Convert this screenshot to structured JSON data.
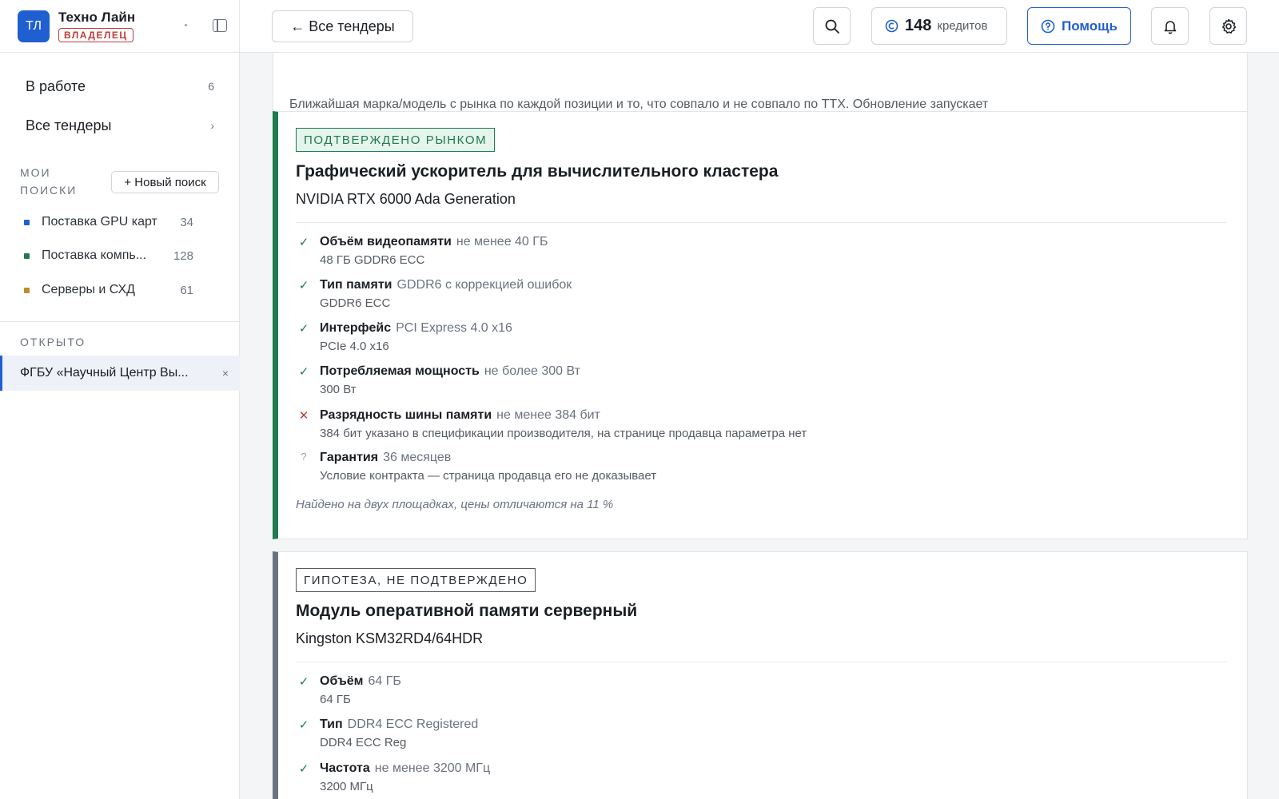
{
  "org": {
    "initials": "ТЛ",
    "name": "Техно Лайн",
    "role": "ВЛАДЕЛЕЦ"
  },
  "nav": {
    "in_work": {
      "label": "В работе",
      "count": "6"
    },
    "all_tenders": {
      "label": "Все тендеры",
      "arrow": "›"
    }
  },
  "my_searches": {
    "label_line1": "МОИ",
    "label_line2": "ПОИСКИ",
    "new_button": "+ Новый поиск",
    "items": [
      {
        "label": "Поставка GPU карт",
        "count": "34",
        "color": "#1f5fd1"
      },
      {
        "label": "Поставка компь...",
        "count": "128",
        "color": "#1f7a4c"
      },
      {
        "label": "Серверы и СХД",
        "count": "61",
        "color": "#c08a2e"
      }
    ]
  },
  "opened": {
    "label": "ОТКРЫТО",
    "item": "ФГБУ «Научный Центр Вы...",
    "close": "×"
  },
  "topbar": {
    "back": "← Все тендеры",
    "credits_count": "148",
    "credits_unit": "кредитов",
    "help": "Помощь"
  },
  "intro": {
    "text": "Ближайшая марка/модель с рынка по каждой позиции и то, что совпало и не совпало по ТТХ. Обновление запускает новый платный прогон LLM и поиска."
  },
  "cards": [
    {
      "tag": "ПОДТВЕРЖДЕНО РЫНКОМ",
      "title": "Графический ускоритель для вычислительного кластера",
      "model": "NVIDIA RTX 6000 Ada Generation",
      "specs": [
        {
          "status": "ok",
          "mark": "✓",
          "name": "Объём видеопамяти",
          "req": "не менее 40 ГБ",
          "found": "48 ГБ GDDR6 ECC"
        },
        {
          "status": "ok",
          "mark": "✓",
          "name": "Тип памяти",
          "req": "GDDR6 с коррекцией ошибок",
          "found": "GDDR6 ECC"
        },
        {
          "status": "ok",
          "mark": "✓",
          "name": "Интерфейс",
          "req": "PCI Express 4.0 x16",
          "found": "PCIe 4.0 x16"
        },
        {
          "status": "ok",
          "mark": "✓",
          "name": "Потребляемая мощность",
          "req": "не более 300 Вт",
          "found": "300 Вт"
        },
        {
          "status": "bad",
          "mark": "✕",
          "name": "Разрядность шины памяти",
          "req": "не менее 384 бит",
          "found": "384 бит указано в спецификации производителя, на странице продавца параметра нет"
        },
        {
          "status": "unk",
          "mark": "?",
          "name": "Гарантия",
          "req": "36 месяцев",
          "found": "Условие контракта — страница продавца его не доказывает"
        }
      ],
      "note": "Найдено на двух площадках, цены отличаются на 11 %"
    },
    {
      "tag": "ГИПОТЕЗА, НЕ ПОДТВЕРЖДЕНО",
      "title": "Модуль оперативной памяти серверный",
      "model": "Kingston KSM32RD4/64HDR",
      "specs": [
        {
          "status": "ok",
          "mark": "✓",
          "name": "Объём",
          "req": "64 ГБ",
          "found": "64 ГБ"
        },
        {
          "status": "ok",
          "mark": "✓",
          "name": "Тип",
          "req": "DDR4 ECC Registered",
          "found": "DDR4 ECC Reg"
        },
        {
          "status": "ok",
          "mark": "✓",
          "name": "Частота",
          "req": "не менее 3200 МГц",
          "found": "3200 МГц"
        }
      ]
    }
  ],
  "colors": {
    "accent": "#1f5fd1",
    "confirmed": "#1f7a4c",
    "mismatch": "#c23a3a"
  },
  "icons": {
    "search": "search-icon",
    "bell": "bell-icon",
    "settings": "gear-icon",
    "help": "help-circle-icon",
    "credits": "coin-icon",
    "sidebar_toggle": "sidebar-toggle-icon"
  }
}
